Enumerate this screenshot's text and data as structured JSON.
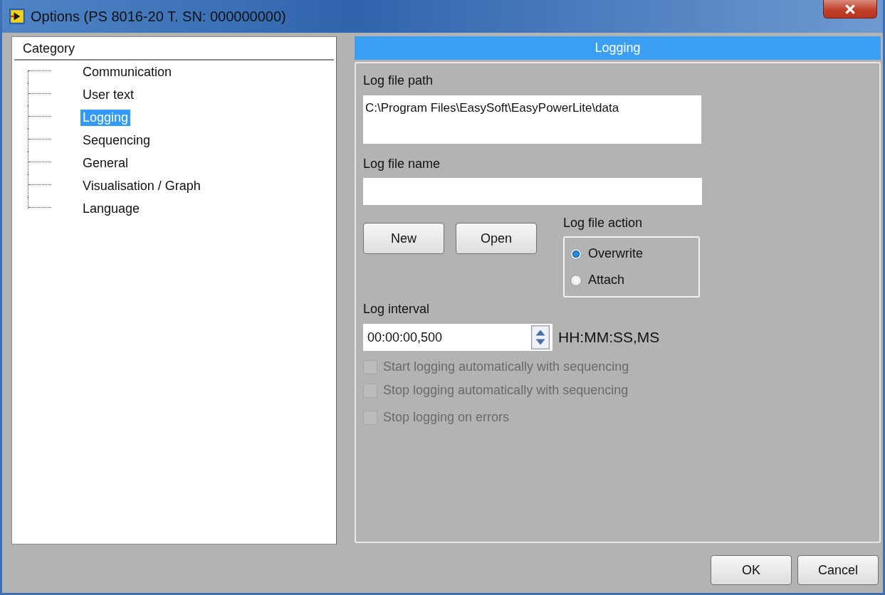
{
  "window": {
    "title": "Options (PS 8016-20 T. SN: 000000000)"
  },
  "category": {
    "header": "Category",
    "items": [
      {
        "label": "Communication",
        "selected": false
      },
      {
        "label": "User text",
        "selected": false
      },
      {
        "label": "Logging",
        "selected": true
      },
      {
        "label": "Sequencing",
        "selected": false
      },
      {
        "label": "General",
        "selected": false
      },
      {
        "label": "Visualisation / Graph",
        "selected": false
      },
      {
        "label": "Language",
        "selected": false
      }
    ]
  },
  "panel": {
    "title": "Logging",
    "log_file_path": {
      "label": "Log file path",
      "value": "C:\\Program Files\\EasySoft\\EasyPowerLite\\data"
    },
    "log_file_name": {
      "label": "Log file name"
    },
    "buttons": [
      "New",
      "Open"
    ],
    "log_file_action": {
      "label": "Log file action",
      "options": [
        {
          "label": "Overwrite",
          "selected": true
        },
        {
          "label": "Attach",
          "selected": false
        }
      ]
    },
    "log_interval": {
      "label": "Log interval",
      "value": "00:00:00,500",
      "unit": "HH:MM:SS,MS"
    },
    "checkboxes": [
      {
        "label": "Start logging automatically with sequencing",
        "checked": false,
        "disabled": true
      },
      {
        "label": "Stop logging automatically with sequencing",
        "checked": false,
        "disabled": true
      },
      {
        "label": "Stop logging on errors",
        "checked": false,
        "disabled": true
      }
    ]
  },
  "buttons": [
    "OK",
    "Cancel"
  ]
}
